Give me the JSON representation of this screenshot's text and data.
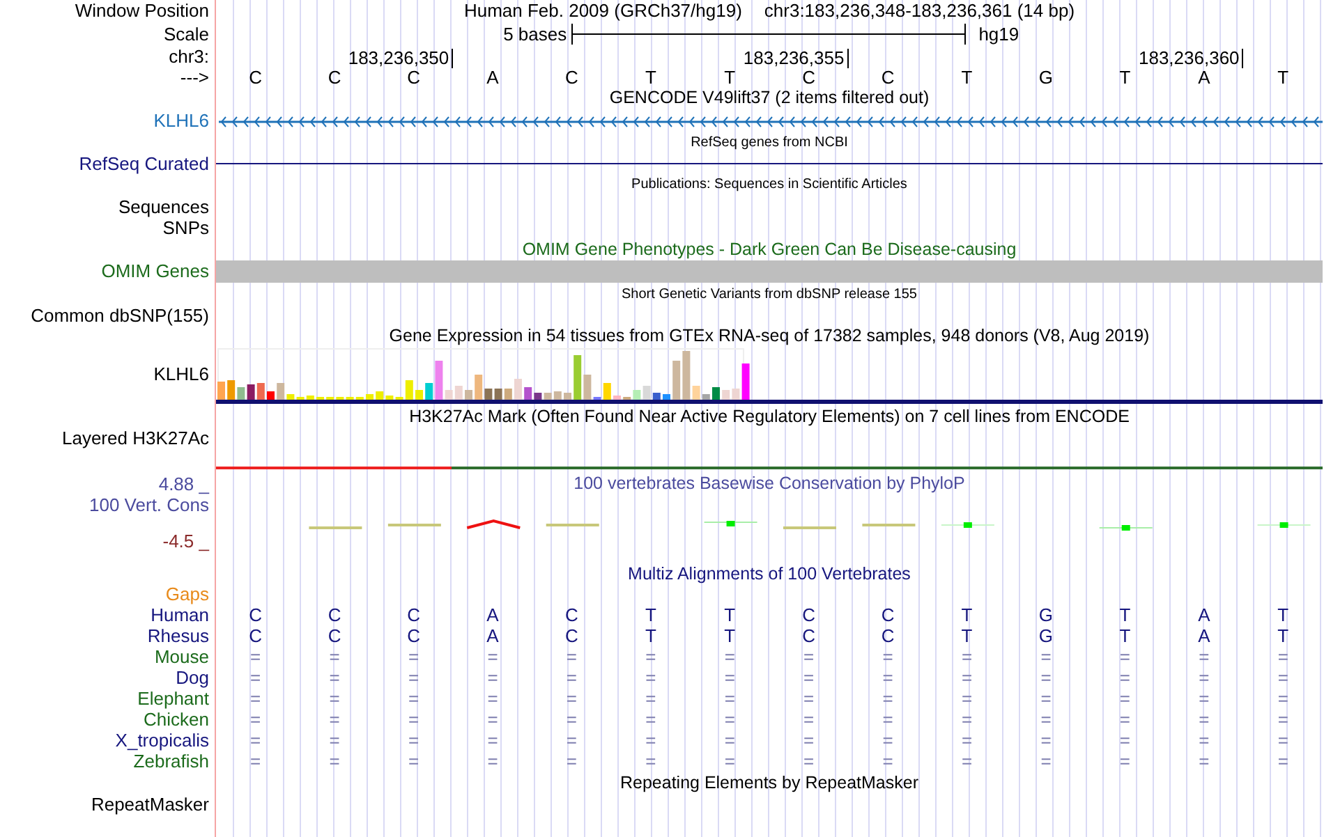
{
  "header": {
    "position_label": "Window Position",
    "assembly": "Human Feb. 2009 (GRCh37/hg19)",
    "range": "chr3:183,236,348-183,236,361 (14 bp)",
    "scale_label": "Scale",
    "scale_length": "5 bases",
    "scale_db": "hg19",
    "chrom_label": "chr3:",
    "ticks": [
      "183,236,350",
      "183,236,355",
      "183,236,360"
    ],
    "strand_label": "--->",
    "bases": [
      "C",
      "C",
      "C",
      "A",
      "C",
      "T",
      "T",
      "C",
      "C",
      "T",
      "G",
      "T",
      "A",
      "T"
    ]
  },
  "tracks": [
    {
      "kind": "gene",
      "title": "GENCODE V49lift37 (2 items filtered out)",
      "label": "KLHL6",
      "color": "#1f72b8"
    },
    {
      "kind": "line",
      "title": "RefSeq genes from NCBI",
      "label": "RefSeq Curated",
      "color": "#16167e"
    },
    {
      "kind": "title",
      "title": "Publications: Sequences in Scientific Articles"
    },
    {
      "kind": "labels",
      "labels": [
        "Sequences",
        "SNPs"
      ]
    },
    {
      "kind": "bar",
      "title": "OMIM Gene Phenotypes - Dark Green Can Be Disease-causing",
      "label": "OMIM Genes",
      "color": "#1c6b1c"
    },
    {
      "kind": "empty",
      "title": "Short Genetic Variants from dbSNP release 155",
      "label": "Common dbSNP(155)"
    },
    {
      "kind": "expression",
      "title": "Gene Expression in 54 tissues from GTEx RNA-seq of 17382 samples, 948 donors (V8, Aug 2019)",
      "label": "KLHL6"
    },
    {
      "kind": "signal",
      "title": "H3K27Ac Mark (Often Found Near Active Regulatory Elements) on 7 cell lines from ENCODE",
      "label": "Layered H3K27Ac"
    },
    {
      "kind": "wiggle",
      "title": "100 vertebrates Basewise Conservation by PhyloP",
      "label": "100 Vert. Cons",
      "max": "4.88 _",
      "min": "-4.5 _",
      "color": "#4b4b9e"
    },
    {
      "kind": "alignment",
      "title": "Multiz Alignments of 100 Vertebrates",
      "gaps_label": "Gaps",
      "rows": [
        {
          "name": "Human",
          "color": "#16167e",
          "kind": "bases",
          "bases": [
            "C",
            "C",
            "C",
            "A",
            "C",
            "T",
            "T",
            "C",
            "C",
            "T",
            "G",
            "T",
            "A",
            "T"
          ]
        },
        {
          "name": "Rhesus",
          "color": "#16167e",
          "kind": "bases",
          "bases": [
            "C",
            "C",
            "C",
            "A",
            "C",
            "T",
            "T",
            "C",
            "C",
            "T",
            "G",
            "T",
            "A",
            "T"
          ]
        },
        {
          "name": "Mouse",
          "color": "#1c6b1c",
          "kind": "match",
          "bases": [
            "=",
            "=",
            "=",
            "=",
            "=",
            "=",
            "=",
            "=",
            "=",
            "=",
            "=",
            "=",
            "=",
            "="
          ]
        },
        {
          "name": "Dog",
          "color": "#16167e",
          "kind": "match",
          "bases": [
            "=",
            "=",
            "=",
            "=",
            "=",
            "=",
            "=",
            "=",
            "=",
            "=",
            "=",
            "=",
            "=",
            "="
          ]
        },
        {
          "name": "Elephant",
          "color": "#1c6b1c",
          "kind": "match",
          "bases": [
            "=",
            "=",
            "=",
            "=",
            "=",
            "=",
            "=",
            "=",
            "=",
            "=",
            "=",
            "=",
            "=",
            "="
          ]
        },
        {
          "name": "Chicken",
          "color": "#1c6b1c",
          "kind": "match",
          "bases": [
            "=",
            "=",
            "=",
            "=",
            "=",
            "=",
            "=",
            "=",
            "=",
            "=",
            "=",
            "=",
            "=",
            "="
          ]
        },
        {
          "name": "X_tropicalis",
          "color": "#16167e",
          "kind": "match",
          "bases": [
            "=",
            "=",
            "=",
            "=",
            "=",
            "=",
            "=",
            "=",
            "=",
            "=",
            "=",
            "=",
            "=",
            "="
          ]
        },
        {
          "name": "Zebrafish",
          "color": "#1c6b1c",
          "kind": "match",
          "bases": [
            "=",
            "=",
            "=",
            "=",
            "=",
            "=",
            "=",
            "=",
            "=",
            "=",
            "=",
            "=",
            "=",
            "="
          ]
        }
      ]
    },
    {
      "kind": "repeat",
      "title": "Repeating Elements by RepeatMasker",
      "label": "RepeatMasker"
    }
  ]
}
